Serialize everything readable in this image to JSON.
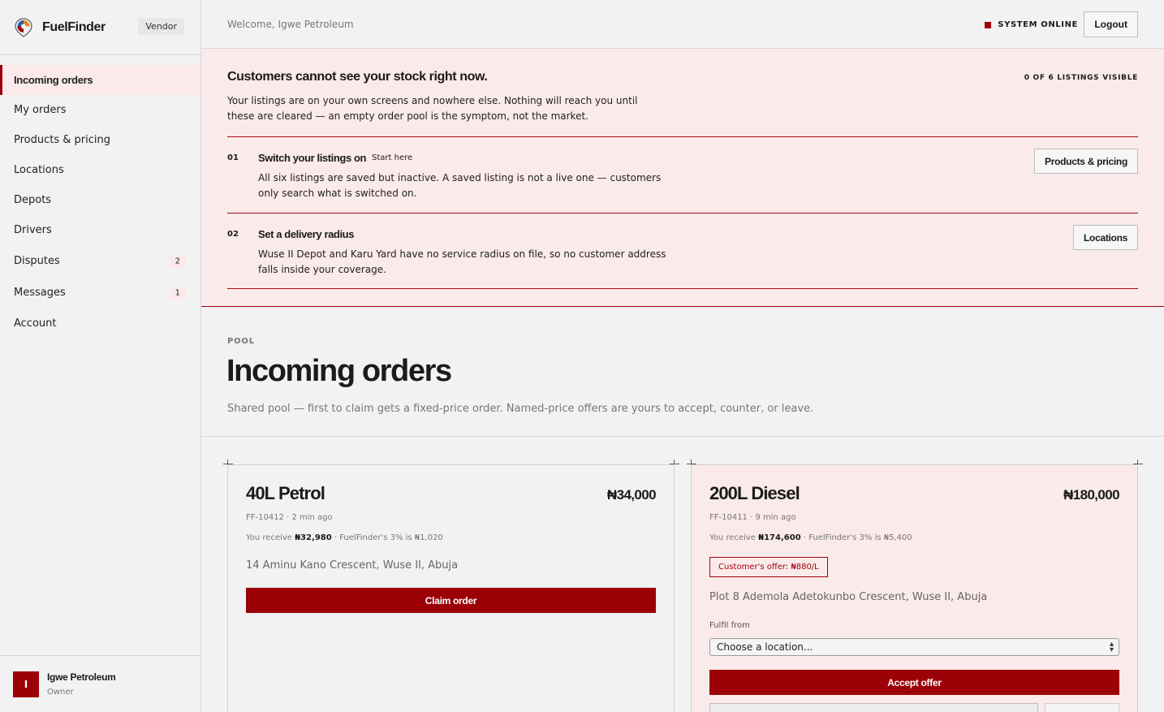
{
  "app": {
    "name": "FuelFinder",
    "badge": "Vendor"
  },
  "sidebar": {
    "items": [
      {
        "label": "Incoming orders"
      },
      {
        "label": "My orders"
      },
      {
        "label": "Products & pricing"
      },
      {
        "label": "Locations"
      },
      {
        "label": "Depots"
      },
      {
        "label": "Drivers"
      },
      {
        "label": "Disputes",
        "count": "2"
      },
      {
        "label": "Messages",
        "count": "1"
      },
      {
        "label": "Account"
      }
    ]
  },
  "user": {
    "initial": "I",
    "name": "Igwe Petroleum",
    "role": "Owner"
  },
  "topbar": {
    "welcome": "Welcome, Igwe Petroleum",
    "status": "SYSTEM ONLINE",
    "logout": "Logout"
  },
  "alert": {
    "title": "Customers cannot see your stock right now.",
    "visible_count": "0 OF 6 LISTINGS VISIBLE",
    "body": "Your listings are on your own screens and nowhere else. Nothing will reach you until these are cleared — an empty order pool is the symptom, not the market.",
    "steps": [
      {
        "num": "01",
        "title": "Switch your listings on",
        "tag": "Start here",
        "body": "All six listings are saved but inactive. A saved listing is not a live one — customers only search what is switched on.",
        "button": "Products & pricing"
      },
      {
        "num": "02",
        "title": "Set a delivery radius",
        "body": "Wuse II Depot and Karu Yard have no service radius on file, so no customer address falls inside your coverage.",
        "button": "Locations"
      }
    ]
  },
  "main": {
    "eyebrow": "POOL",
    "title": "Incoming orders",
    "subtitle": "Shared pool — first to claim gets a fixed-price order. Named-price offers are yours to accept, counter, or leave."
  },
  "orders": [
    {
      "title": "40L Petrol",
      "price": "₦34,000",
      "meta": "FF-10412 · 2 min ago",
      "receive_prefix": "You receive ",
      "receive_amount": "₦32,980",
      "fee_text": " · FuelFinder's 3% is ₦1,020",
      "address": "14 Aminu Kano Crescent, Wuse II, Abuja",
      "button": "Claim order"
    },
    {
      "title": "200L Diesel",
      "price": "₦180,000",
      "meta": "FF-10411 · 9 min ago",
      "receive_prefix": "You receive ",
      "receive_amount": "₦174,600",
      "fee_text": " · FuelFinder's 3% is ₦5,400",
      "offer": "Customer's offer: ₦880/L",
      "address": "Plot 8 Ademola Adetokunbo Crescent, Wuse II, Abuja",
      "fulfil_label": "Fulfil from",
      "fulfil_select": "Choose a location...",
      "button": "Accept offer"
    }
  ],
  "colors": {
    "accent": "#9c0108",
    "alert_bg": "#fbeaea",
    "page_bg": "#f2f2f2"
  }
}
